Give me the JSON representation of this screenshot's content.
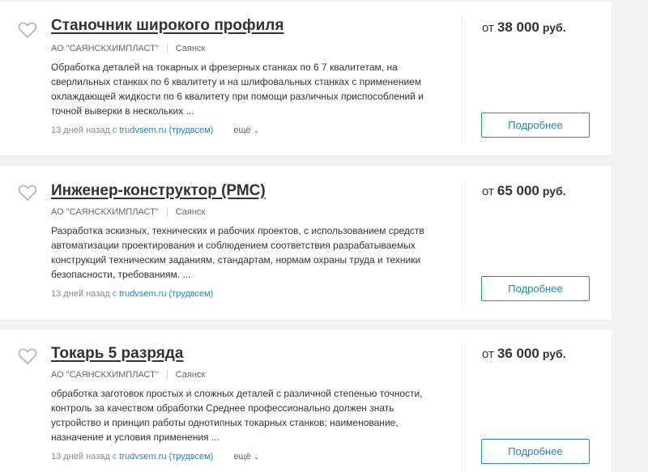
{
  "colors": {
    "accent": "#2b84c6",
    "background": "#f2f2f2",
    "card": "#ffffff"
  },
  "icons": {
    "favorite": "heart-outline-icon",
    "more": "chevron-down-icon"
  },
  "vacancies": [
    {
      "title": "Станочник широкого профиля",
      "company": "АО \"САЯНСКХИМПЛАСТ\"",
      "city": "Саянск",
      "description": "Обработка деталей на токарных и фрезерных станках по 6 7 квалитетам, на сверлильных станках по 6 квалитету и на шлифовальных станках с применением охлаждающей жидкости по 6 квалитету при помощи различных приспособлений и точной выверки в нескольких ...",
      "posted": "13 дней назад с ",
      "source": "trudvsem.ru (трудвсем)",
      "more_label": "ещё",
      "salary_prefix": "от",
      "salary_amount": "38 000",
      "salary_currency": "руб.",
      "details_label": "Подробнее"
    },
    {
      "title": "Инженер-конструктор (РМС)",
      "company": "АО \"САЯНСКХИМПЛАСТ\"",
      "city": "Саянск",
      "description": "Разработка эскизных, технических и рабочих проектов, с использованием средств автоматизации проектирования и соблюдением соответствия разрабатываемых конструкций техническим заданиям, стандартам, нормам охраны труда и техники безопасности, требованиям. ...",
      "posted": "13 дней назад с ",
      "source": "trudvsem.ru (трудвсем)",
      "salary_prefix": "от",
      "salary_amount": "65 000",
      "salary_currency": "руб.",
      "details_label": "Подробнее"
    },
    {
      "title": "Токарь 5 разряда",
      "company": "АО \"САЯНСКХИМПЛАСТ\"",
      "city": "Саянск",
      "description": "обработка заготовок простых и сложных деталей с различной степенью точности, контроль за качеством обработки Среднее профессионально должен знать устройство и принцип работы однотипных токарных станков; наименование, назначение и условия применения ...",
      "posted": "13 дней назад с ",
      "source": "trudvsem.ru (трудвсем)",
      "more_label": "ещё",
      "salary_prefix": "от",
      "salary_amount": "36 000",
      "salary_currency": "руб.",
      "details_label": "Подробнее"
    }
  ]
}
